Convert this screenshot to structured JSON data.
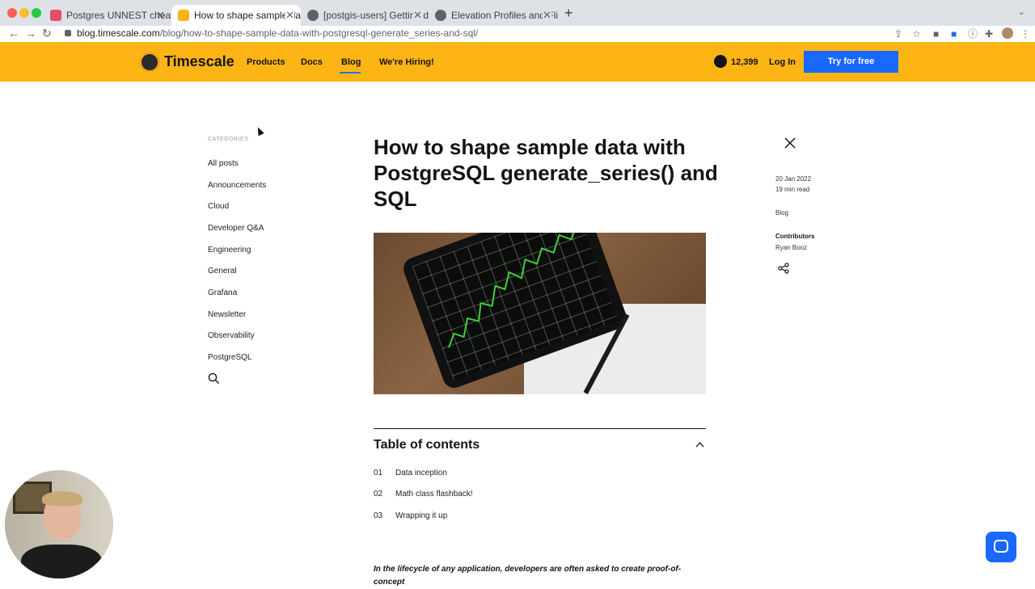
{
  "browser": {
    "tabs": [
      {
        "label": "Postgres UNNEST cheat sheet",
        "active": false
      },
      {
        "label": "How to shape sample data wit",
        "active": true
      },
      {
        "label": "[postgis-users] Getting data fr",
        "active": false
      },
      {
        "label": "Elevation Profiles and Flightlin",
        "active": false
      }
    ],
    "url_host": "blog.timescale.com",
    "url_path": "/blog/how-to-shape-sample-data-with-postgresql-generate_series-and-sql/"
  },
  "site": {
    "brand": "Timescale",
    "nav": [
      "Products",
      "Docs",
      "Blog",
      "We're Hiring!"
    ],
    "github_stars": "12,399",
    "login": "Log In",
    "cta": "Try for free",
    "brand_color": "#fdb515",
    "accent_color": "#1968ff"
  },
  "sidebar": {
    "heading": "CATEGORIES",
    "items": [
      "All posts",
      "Announcements",
      "Cloud",
      "Developer Q&A",
      "Engineering",
      "General",
      "Grafana",
      "Newsletter",
      "Observability",
      "PostgreSQL"
    ]
  },
  "article": {
    "title": "How to shape sample data with PostgreSQL generate_series() and SQL",
    "toc_title": "Table of contents",
    "toc": [
      {
        "num": "01",
        "label": "Data inception"
      },
      {
        "num": "02",
        "label": "Math class flashback!"
      },
      {
        "num": "03",
        "label": "Wrapping it up"
      }
    ],
    "intro": "In the lifecycle of any application, developers are often asked to create proof-of-concept"
  },
  "meta": {
    "date": "20 Jan 2022",
    "read_time": "19 min read",
    "category": "Blog",
    "contributors_label": "Contributors",
    "contributor": "Ryan Booz"
  }
}
